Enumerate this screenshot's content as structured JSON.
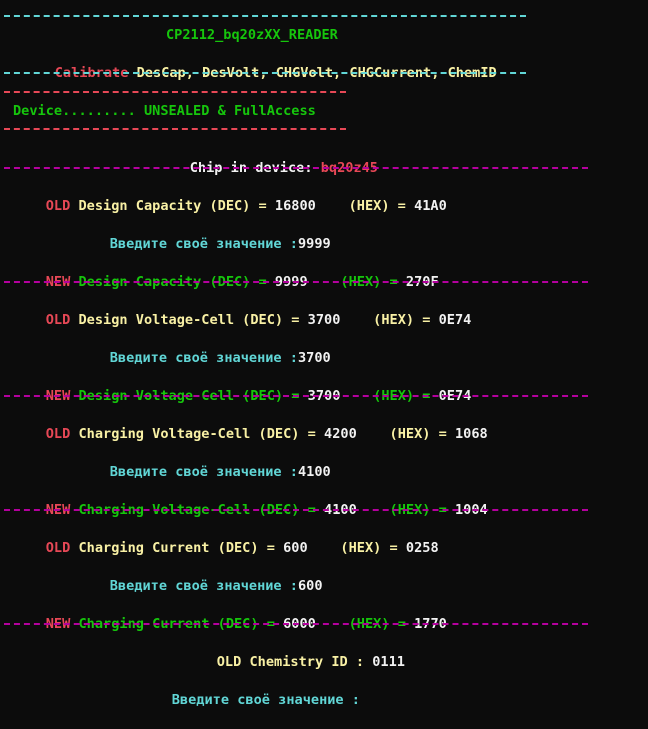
{
  "header": {
    "title": "CP2112_bq20zXX_READER",
    "calibrate_label": "Calibrate",
    "calibrate_items": "DesCap, DesVolt, CHGVolt, CHGCurrent, ChemID"
  },
  "device": {
    "label": "Device......... UNSEALED & FullAccess",
    "chip_label": "Chip in device: ",
    "chip_value": "bq20z45"
  },
  "prompt_text": "Введите своё значение :",
  "entries": [
    {
      "name": "Design Capacity (DEC) = ",
      "old_dec": "16800",
      "old_hex": "41A0",
      "input": "9999",
      "new_dec": "9999",
      "new_hex": "270F"
    },
    {
      "name": "Design Voltage-Cell (DEC) = ",
      "old_dec": "3700",
      "old_hex": "0E74",
      "input": "3700",
      "new_dec": "3700",
      "new_hex": "0E74"
    },
    {
      "name": "Charging Voltage-Cell (DEC) = ",
      "old_dec": "4200",
      "old_hex": "1068",
      "input": "4100",
      "new_dec": "4100",
      "new_hex": "1004"
    },
    {
      "name": "Charging Current (DEC) = ",
      "old_dec": "600",
      "old_hex": "0258",
      "input": "600",
      "new_dec": "6000",
      "new_hex": "1770"
    }
  ],
  "tags": {
    "old": "OLD",
    "new": "NEW",
    "hex": "    (HEX) = "
  },
  "chemistry": {
    "label": "OLD Chemistry ID : ",
    "value": "0111",
    "prompt": "Введите своё значение :"
  },
  "colors": {
    "background": "#0c0c0c",
    "cyan": "#61d6d6",
    "green": "#16c60c",
    "red": "#e74856",
    "yellow": "#f9f1a5",
    "white": "#f2f2f2",
    "magenta": "#b4009e"
  }
}
